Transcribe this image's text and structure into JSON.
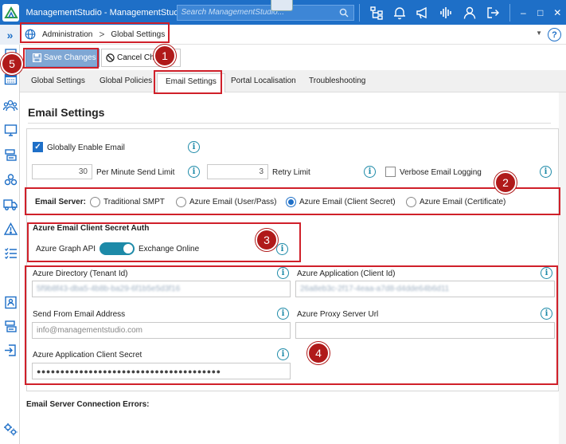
{
  "window": {
    "title": "ManagementStudio - ManagementStudio",
    "search_placeholder": "Search ManagementStudio...",
    "minimize": "–",
    "maximize": "□",
    "close": "✕"
  },
  "breadcrumb": {
    "items": [
      "Administration",
      "Global Settings"
    ],
    "separator": ">",
    "filter_glyph": "▼",
    "help_glyph": "?"
  },
  "toolbar": {
    "save_label": "Save Changes",
    "cancel_label": "Cancel Changes"
  },
  "tabs": [
    {
      "label": "Global Settings",
      "active": false
    },
    {
      "label": "Global Policies",
      "active": false
    },
    {
      "label": "Email Settings",
      "active": true
    },
    {
      "label": "Portal Localisation",
      "active": false
    },
    {
      "label": "Troubleshooting",
      "active": false
    }
  ],
  "page": {
    "title": "Email Settings",
    "globally_enable_label": "Globally Enable Email",
    "globally_enable_checked": true,
    "per_minute_value": "30",
    "per_minute_label": "Per Minute Send Limit",
    "retry_value": "3",
    "retry_label": "Retry Limit",
    "verbose_label": "Verbose Email Logging",
    "verbose_checked": false,
    "email_server_label": "Email Server:",
    "server_options": [
      {
        "label": "Traditional SMPT",
        "selected": false
      },
      {
        "label": "Azure Email (User/Pass)",
        "selected": false
      },
      {
        "label": "Azure Email (Client Secret)",
        "selected": true
      },
      {
        "label": "Azure Email (Certificate)",
        "selected": false
      }
    ],
    "auth_title": "Azure Email Client Secret Auth",
    "toggle_left_label": "Azure Graph API",
    "toggle_right_label": "Exchange Online",
    "tenant_label": "Azure Directory (Tenant Id)",
    "tenant_value": "5f9b8f43-dba5-4b8b-ba29-6f1b5e5d3f16",
    "client_label": "Azure Application (Client Id)",
    "client_value": "26a8eb3c-2f17-4eaa-a7d8-d4dde64b6d11",
    "send_from_label": "Send From Email Address",
    "send_from_placeholder": "info@managementstudio.com",
    "proxy_label": "Azure Proxy Server Url",
    "proxy_value": "",
    "secret_label": "Azure Application Client Secret",
    "secret_value": "●●●●●●●●●●●●●●●●●●●●●●●●●●●●●●●●●●●●●●●",
    "errors_label": "Email Server Connection Errors:",
    "info_glyph": "i",
    "check_glyph": "✓"
  },
  "annotations": [
    "1",
    "2",
    "3",
    "4",
    "5"
  ],
  "colors": {
    "titlebar": "#1e6fc7",
    "accent": "#1e6fc7",
    "info": "#1d8aa8",
    "annotation_red": "#d0202a"
  }
}
